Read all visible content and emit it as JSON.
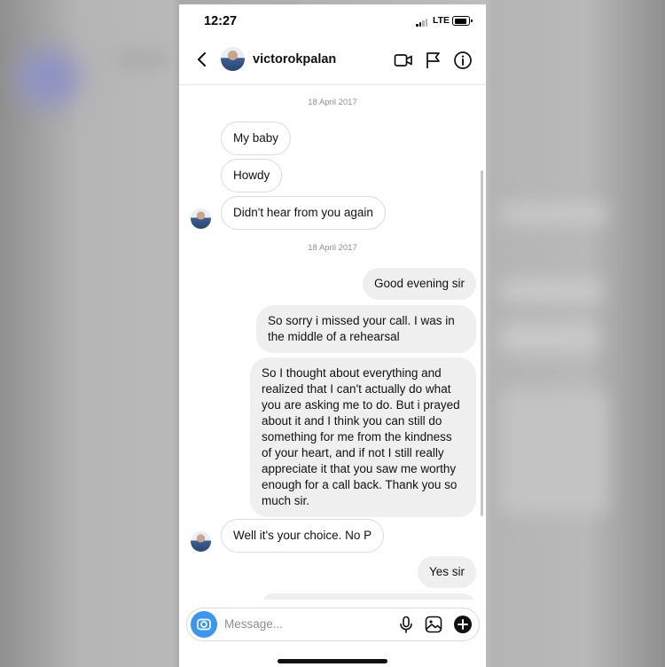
{
  "status": {
    "time": "12:27",
    "network": "LTE"
  },
  "header": {
    "username": "victorokpalan"
  },
  "thread": {
    "date_1": "18 April 2017",
    "date_2": "18 April 2017",
    "incoming_1": "My baby",
    "incoming_2": "Howdy",
    "incoming_3": "Didn't hear from you again",
    "outgoing_1": "Good evening sir",
    "outgoing_2": "So sorry i missed your call. I was in the middle of a rehearsal",
    "outgoing_3": "So I thought about everything and realized that I can't actually do what you are asking me to do. But i prayed about it and I think you can still do something for me from the kindness of your heart, and if not I still really appreciate it that you saw me worthy enough for a call back. Thank you so much sir.",
    "incoming_4": "Well it's your choice. No P",
    "outgoing_4": "Yes sir"
  },
  "composer": {
    "placeholder": "Message..."
  },
  "colors": {
    "accent": "#3897f0",
    "outgoing_bubble": "#efefef",
    "incoming_border": "#dbdbdb"
  },
  "icons": [
    "back-chevron-icon",
    "video-call-icon",
    "flag-icon",
    "info-icon",
    "camera-icon",
    "microphone-icon",
    "gallery-icon",
    "plus-icon"
  ]
}
